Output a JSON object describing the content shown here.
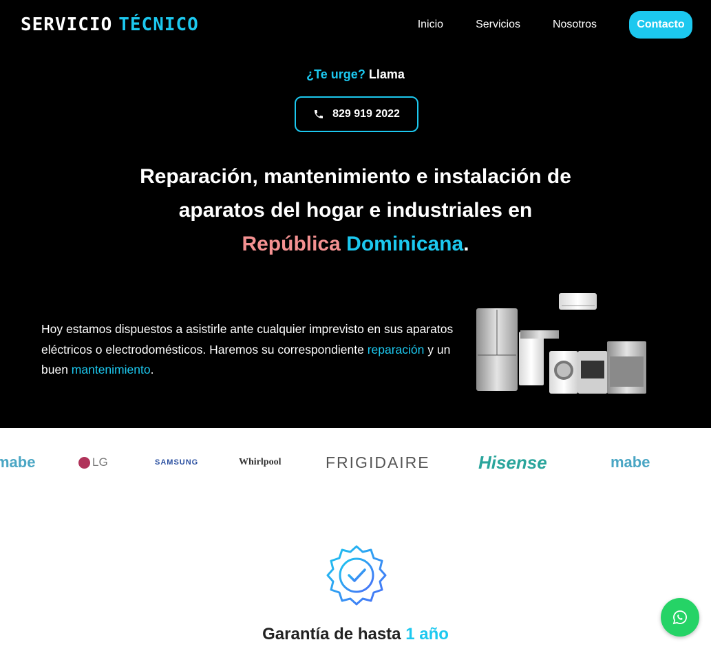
{
  "brand": {
    "word1": "SERVICIO",
    "word2": "TÉCNICO"
  },
  "nav": {
    "items": [
      {
        "label": "Inicio"
      },
      {
        "label": "Servicios"
      },
      {
        "label": "Nosotros"
      }
    ],
    "contact_label": "Contacto"
  },
  "urgent": {
    "question": "¿Te urge?",
    "call": "Llama"
  },
  "phone": {
    "number": "829 919 2022",
    "icon": "phone-icon"
  },
  "headline": {
    "line1": "Reparación, mantenimiento e instalación de",
    "line2": "aparatos del hogar e industriales en",
    "country_part1": "República",
    "country_part2": "Dominicana",
    "period": "."
  },
  "intro": {
    "text1": "Hoy estamos dispuestos a asistirle ante cualquier imprevisto en sus aparatos eléctricos o electrodomésticos. Haremos su correspondiente ",
    "highlight1": "reparación",
    "text2": " y un buen ",
    "highlight2": "mantenimiento",
    "text3": "."
  },
  "brands": {
    "logos": [
      "mabe",
      "LG",
      "SAMSUNG",
      "Whirlpool",
      "FRIGIDAIRE",
      "Hisense",
      "mabe"
    ]
  },
  "guarantee": {
    "text": "Garantía de hasta",
    "highlight": "1 año",
    "icon": "verified-badge-icon"
  },
  "whatsapp": {
    "icon": "whatsapp-icon"
  },
  "colors": {
    "accent": "#1cc8ef",
    "pink": "#f49191",
    "background": "#000000",
    "whatsapp": "#25d366"
  }
}
